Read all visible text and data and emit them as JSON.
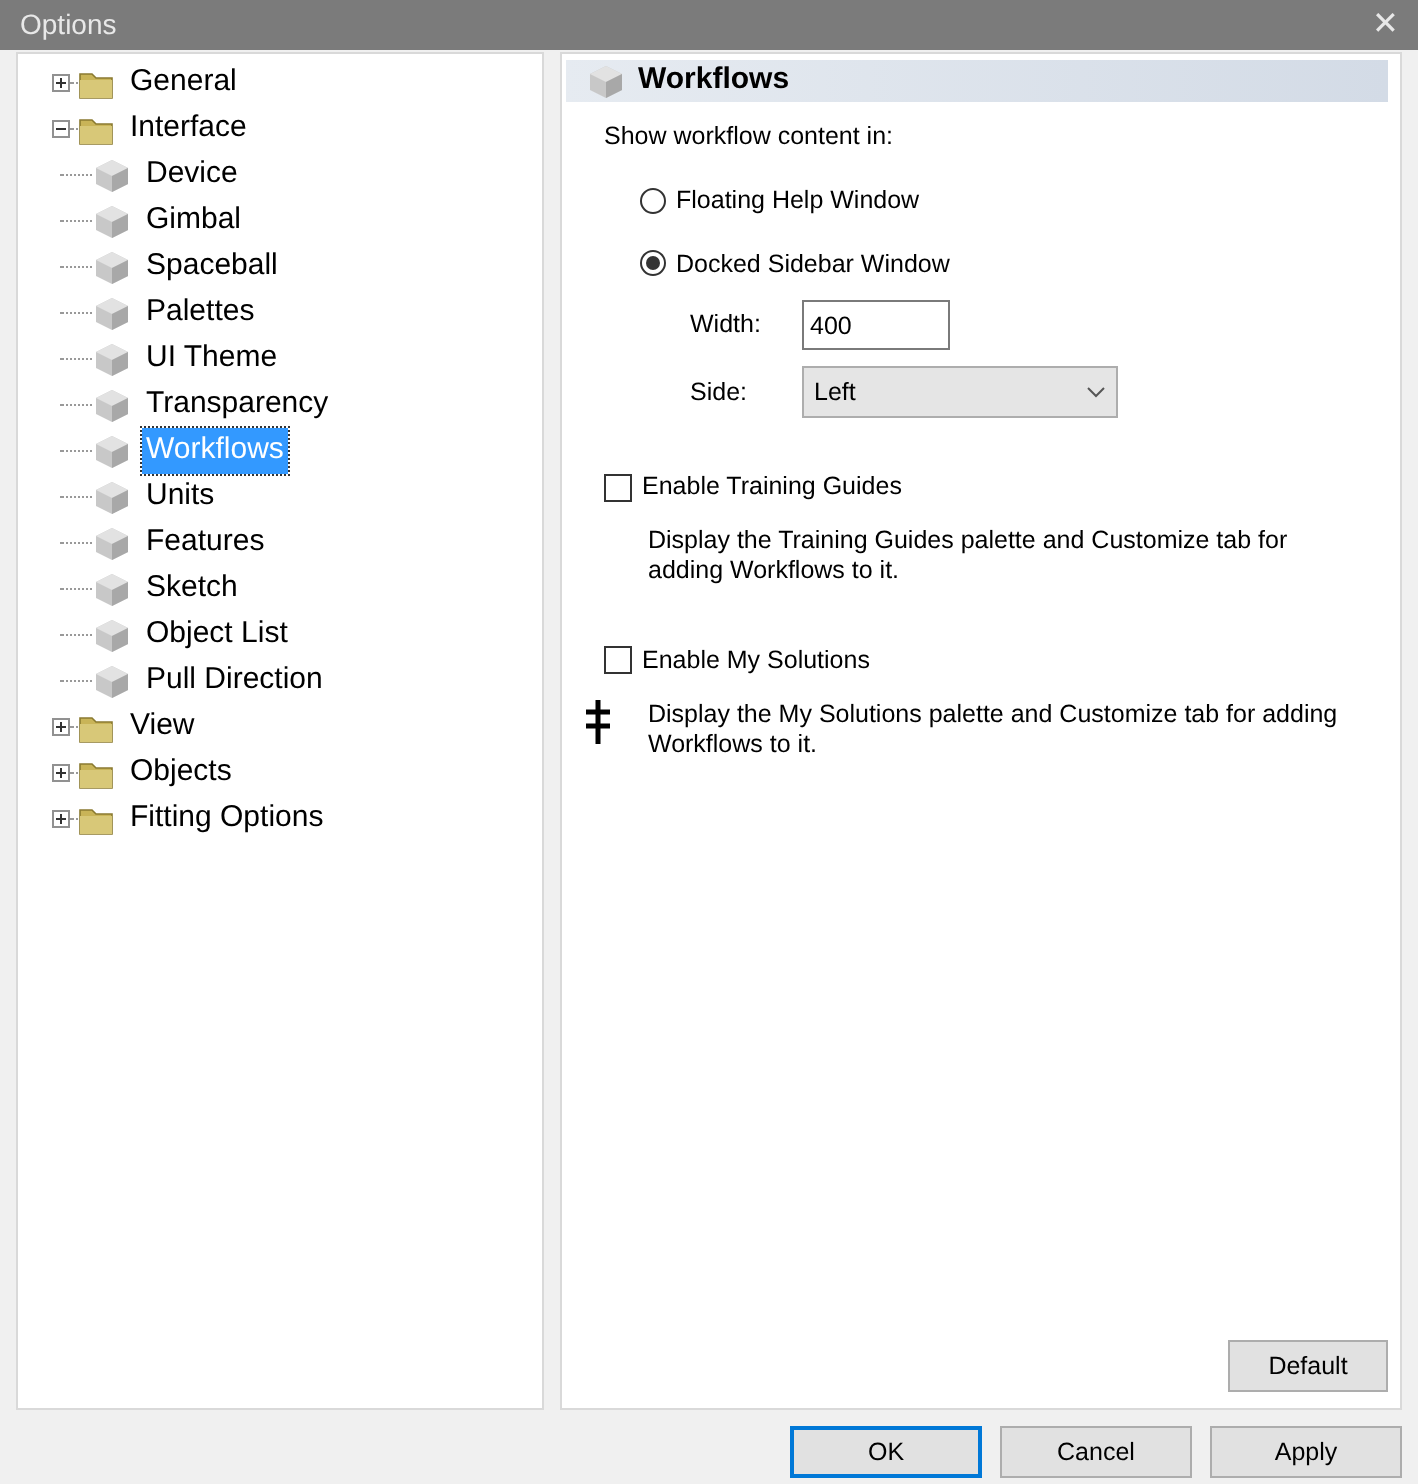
{
  "window": {
    "title": "Options",
    "close": "✕"
  },
  "tree": [
    {
      "label": "General",
      "expanded": false,
      "selected": false
    },
    {
      "label": "Interface",
      "expanded": true,
      "selected": false,
      "children": [
        {
          "label": "Device",
          "selected": false
        },
        {
          "label": "Gimbal",
          "selected": false
        },
        {
          "label": "Spaceball",
          "selected": false
        },
        {
          "label": "Palettes",
          "selected": false
        },
        {
          "label": "UI Theme",
          "selected": false
        },
        {
          "label": "Transparency",
          "selected": false
        },
        {
          "label": "Workflows",
          "selected": true
        },
        {
          "label": "Units",
          "selected": false
        },
        {
          "label": "Features",
          "selected": false
        },
        {
          "label": "Sketch",
          "selected": false
        },
        {
          "label": "Object List",
          "selected": false
        },
        {
          "label": "Pull Direction",
          "selected": false
        }
      ]
    },
    {
      "label": "View",
      "expanded": false,
      "selected": false
    },
    {
      "label": "Objects",
      "expanded": false,
      "selected": false
    },
    {
      "label": "Fitting Options",
      "expanded": false,
      "selected": false
    }
  ],
  "panel": {
    "title": "Workflows",
    "intro": "Show workflow content in:",
    "radios": [
      {
        "label": "Floating Help Window",
        "selected": false
      },
      {
        "label": "Docked Sidebar Window",
        "selected": true
      }
    ],
    "width": {
      "label": "Width:",
      "value": "400"
    },
    "side": {
      "label": "Side:",
      "value": "Left"
    },
    "checkboxes": [
      {
        "label": "Enable Training Guides",
        "checked": false,
        "description": "Display the Training Guides palette and Customize tab for adding Workflows to it."
      },
      {
        "label": "Enable My Solutions",
        "checked": false,
        "description": "Display the My Solutions palette and Customize tab for adding Workflows to it."
      }
    ],
    "default_button": "Default"
  },
  "buttons": [
    {
      "label": "OK",
      "selected": true
    },
    {
      "label": "Cancel",
      "selected": false
    },
    {
      "label": "Apply",
      "selected": false
    }
  ]
}
